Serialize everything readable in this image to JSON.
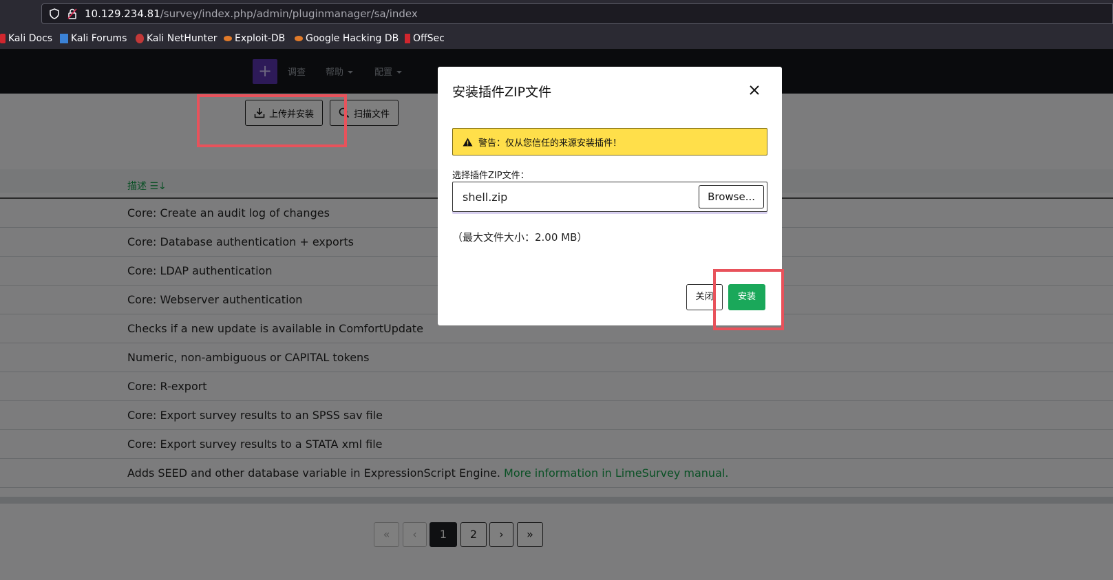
{
  "browser": {
    "url_host": "10.129.234.81",
    "url_path": "/survey/index.php/admin/pluginmanager/sa/index",
    "bookmarks": [
      "Kali Docs",
      "Kali Forums",
      "Kali NetHunter",
      "Exploit-DB",
      "Google Hacking DB",
      "OffSec"
    ]
  },
  "navbar": {
    "plus_label": "+",
    "items": [
      "调查",
      "帮助",
      "配置"
    ]
  },
  "toolbar": {
    "upload_install_label": "上传并安装",
    "scan_files_label": "扫描文件"
  },
  "table": {
    "header": "描述",
    "rows": [
      "Core: Create an audit log of changes",
      "Core: Database authentication + exports",
      "Core: LDAP authentication",
      "Core: Webserver authentication",
      "Checks if a new update is available in ComfortUpdate",
      "Numeric, non-ambiguous or CAPITAL tokens",
      "Core: R-export",
      "Core: Export survey results to an SPSS sav file",
      "Core: Export survey results to a STATA xml file",
      "Adds SEED and other database variable in ExpressionScript Engine."
    ],
    "last_row_link": "More information in LimeSurvey manual."
  },
  "pagination": [
    "«",
    "‹",
    "1",
    "2",
    "›",
    "»"
  ],
  "modal": {
    "title": "安装插件ZIP文件",
    "warning": "警告：仅从您信任的来源安装插件！",
    "file_label": "选择插件ZIP文件：",
    "file_value": "shell.zip",
    "browse_label": "Browse...",
    "size_note": "（最大文件大小：2.00 MB）",
    "close_label": "关闭",
    "install_label": "安装"
  },
  "colors": {
    "accent_green": "#1aa85a",
    "warning_yellow": "#ffdf4a",
    "highlight_red": "#e8525b",
    "brand_purple": "#5b35b0"
  }
}
